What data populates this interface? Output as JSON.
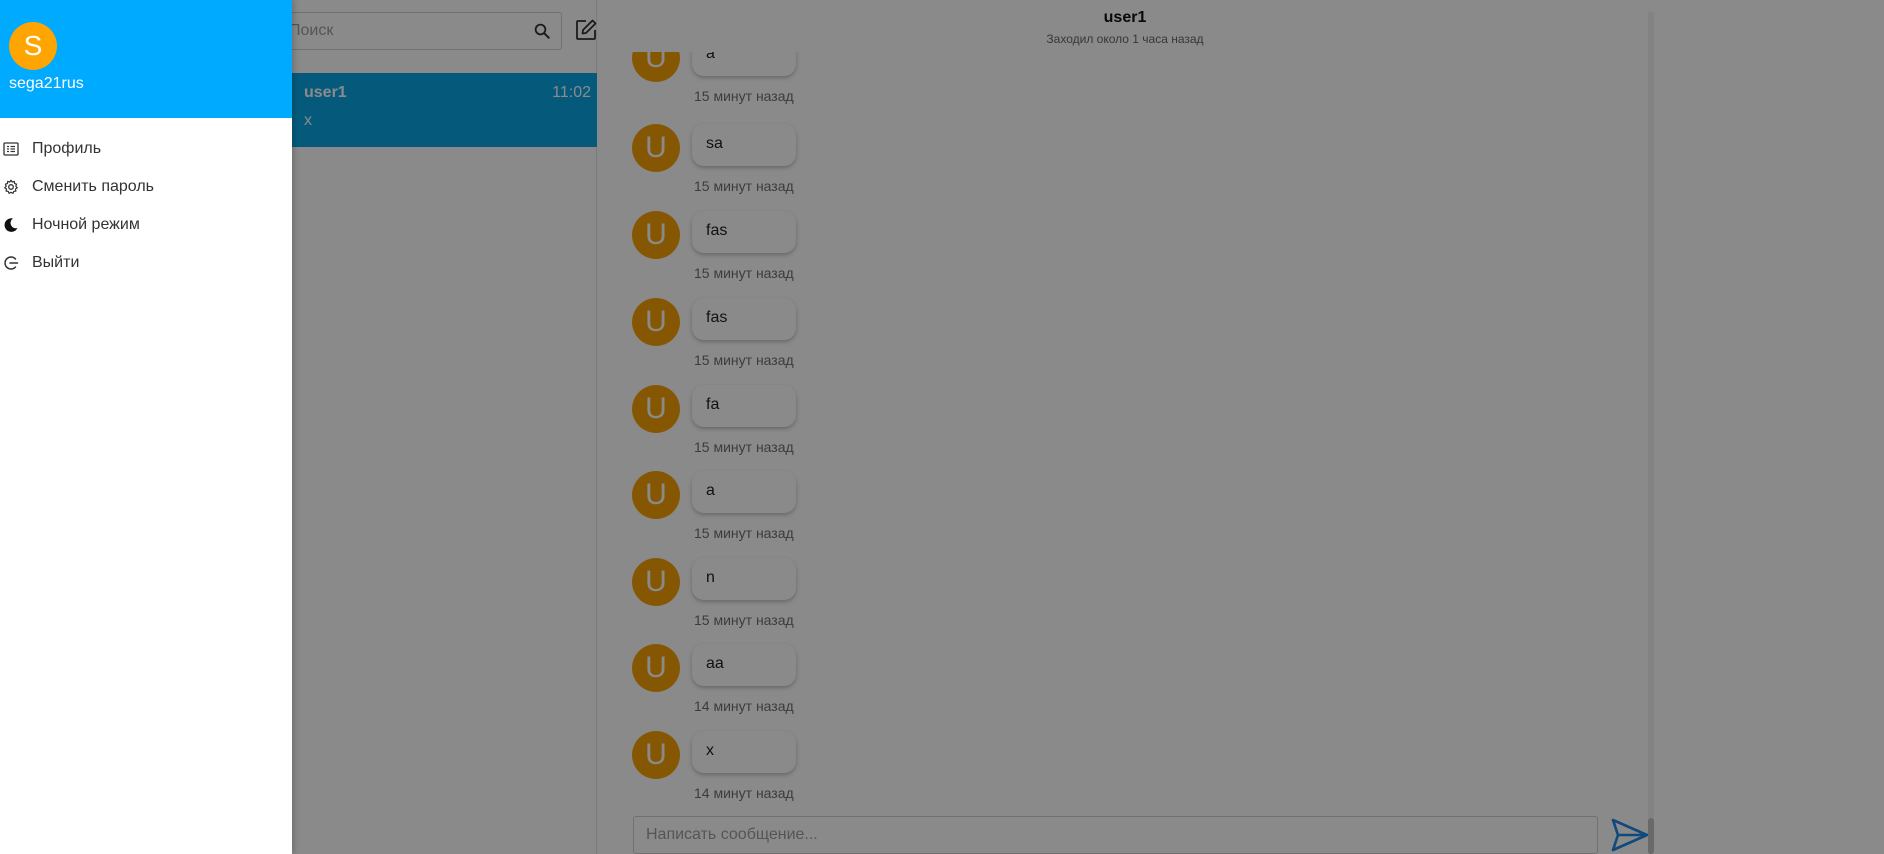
{
  "drawer": {
    "avatar_letter": "S",
    "username": "sega21rus",
    "menu": [
      {
        "label": "Профиль",
        "icon": "profile-icon"
      },
      {
        "label": "Сменить пароль",
        "icon": "gear-icon"
      },
      {
        "label": "Ночной режим",
        "icon": "moon-icon"
      },
      {
        "label": "Выйти",
        "icon": "logout-icon"
      }
    ]
  },
  "sidebar": {
    "search_placeholder": "Поиск",
    "chats": [
      {
        "name": "user1",
        "time": "11:02",
        "last_message": "x"
      }
    ]
  },
  "chat": {
    "title": "user1",
    "status": "Заходил около 1 часа назад",
    "messages": [
      {
        "avatar": "U",
        "text": "a",
        "time": "15 минут назад"
      },
      {
        "avatar": "U",
        "text": "sa",
        "time": "15 минут назад"
      },
      {
        "avatar": "U",
        "text": "fas",
        "time": "15 минут назад"
      },
      {
        "avatar": "U",
        "text": "fas",
        "time": "15 минут назад"
      },
      {
        "avatar": "U",
        "text": "fa",
        "time": "15 минут назад"
      },
      {
        "avatar": "U",
        "text": "a",
        "time": "15 минут назад"
      },
      {
        "avatar": "U",
        "text": "n",
        "time": "15 минут назад"
      },
      {
        "avatar": "U",
        "text": "aa",
        "time": "14 минут назад"
      },
      {
        "avatar": "U",
        "text": "x",
        "time": "14 минут назад"
      }
    ],
    "composer_placeholder": "Написать сообщение..."
  },
  "colors": {
    "drawer_header": "#00aaff",
    "selected_chat": "#0aa6e6",
    "avatar": "#f5a205",
    "send_icon": "#1e88e5"
  }
}
